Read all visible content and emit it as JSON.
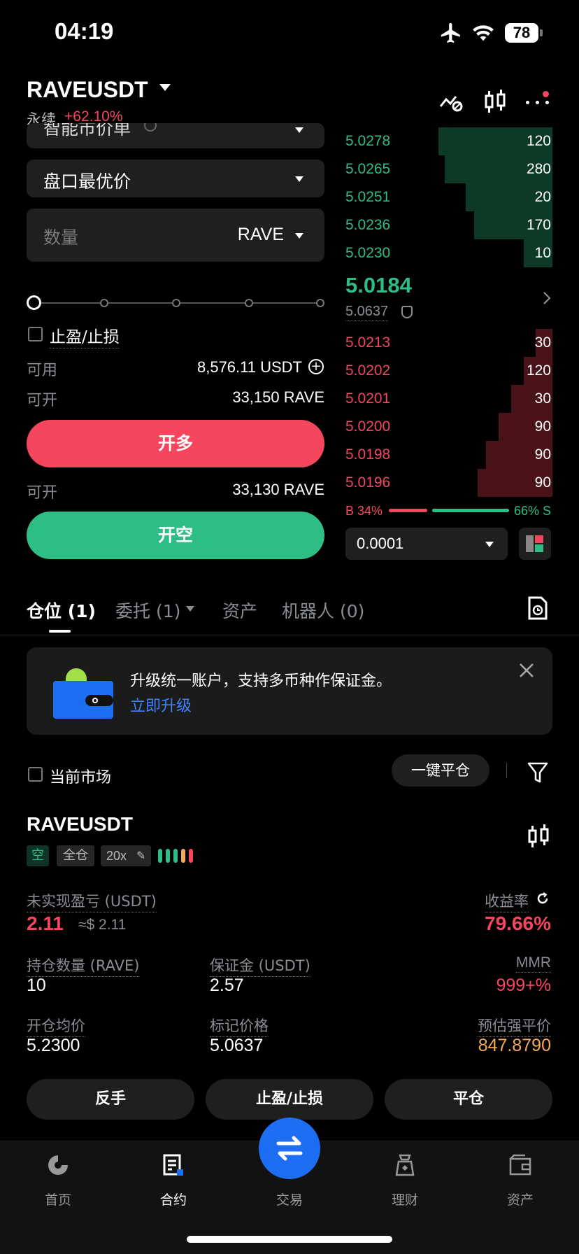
{
  "status_bar": {
    "time": "04:19",
    "battery": "78"
  },
  "header": {
    "pair": "RAVEUSDT",
    "perpetual_label": "永续",
    "change": "+62.10%"
  },
  "order_form": {
    "order_type": "智能市价单",
    "price_type": "盘口最优价",
    "quantity_placeholder": "数量",
    "quantity_unit": "RAVE",
    "tpsl_label": "止盈/止损",
    "available_label": "可用",
    "available_value": "8,576.11 USDT",
    "open_long_label": "可开",
    "open_long_value": "33,150 RAVE",
    "long_button": "开多",
    "open_short_label": "可开",
    "open_short_value": "33,130 RAVE",
    "short_button": "开空"
  },
  "order_book": {
    "asks": [
      {
        "price": "5.0278",
        "qty": "120",
        "depth": 0.55
      },
      {
        "price": "5.0265",
        "qty": "280",
        "depth": 0.52
      },
      {
        "price": "5.0251",
        "qty": "20",
        "depth": 0.42
      },
      {
        "price": "5.0236",
        "qty": "170",
        "depth": 0.38
      },
      {
        "price": "5.0230",
        "qty": "10",
        "depth": 0.14
      }
    ],
    "last_price": "5.0184",
    "mark_price": "5.0637",
    "bids": [
      {
        "price": "5.0213",
        "qty": "30",
        "depth": 0.08
      },
      {
        "price": "5.0202",
        "qty": "120",
        "depth": 0.14
      },
      {
        "price": "5.0201",
        "qty": "30",
        "depth": 0.2
      },
      {
        "price": "5.0200",
        "qty": "90",
        "depth": 0.26
      },
      {
        "price": "5.0198",
        "qty": "90",
        "depth": 0.32
      },
      {
        "price": "5.0196",
        "qty": "90",
        "depth": 0.36
      }
    ],
    "buy_ratio_label": "B 34%",
    "sell_ratio_label": "66% S",
    "buy_ratio": 0.34,
    "precision": "0.0001"
  },
  "tabs": [
    {
      "label": "仓位 (1)"
    },
    {
      "label": "委托 (1)"
    },
    {
      "label": "资产"
    },
    {
      "label": "机器人 (0)"
    }
  ],
  "banner": {
    "text": "升级统一账户，支持多币种作保证金。",
    "link": "立即升级"
  },
  "filter_bar": {
    "current_market": "当前市场",
    "close_all": "一键平仓"
  },
  "position": {
    "symbol": "RAVEUSDT",
    "side_tag": "空",
    "margin_tag": "全仓",
    "leverage": "20x",
    "unrealized_label": "未实现盈亏 (USDT)",
    "unrealized_value": "2.11",
    "unrealized_usd": "≈$ 2.11",
    "roi_label": "收益率",
    "roi_value": "79.66%",
    "size_label": "持仓数量 (RAVE)",
    "size_value": "10",
    "margin_label": "保证金 (USDT)",
    "margin_value": "2.57",
    "mmr_label": "MMR",
    "mmr_value": "999+%",
    "entry_label": "开仓均价",
    "entry_value": "5.2300",
    "mark_label": "标记价格",
    "mark_value": "5.0637",
    "liq_label": "预估强平价",
    "liq_value": "847.8790",
    "btn_reverse": "反手",
    "btn_tpsl": "止盈/止损",
    "btn_close": "平仓"
  },
  "bottom_nav": [
    {
      "label": "首页"
    },
    {
      "label": "合约"
    },
    {
      "label": "交易"
    },
    {
      "label": "理财"
    },
    {
      "label": "资产"
    }
  ]
}
